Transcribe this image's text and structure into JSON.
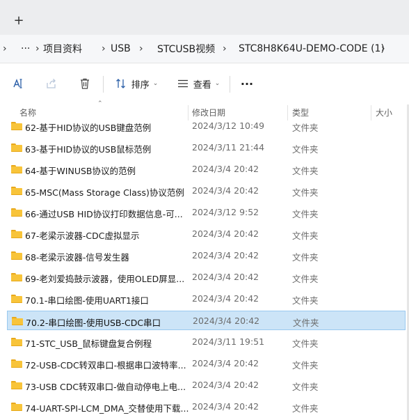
{
  "tabbar": {
    "new_tab_glyph": "+"
  },
  "breadcrumb": {
    "overflow": "···",
    "items": [
      "项目资料",
      "USB",
      "STCUSB视频",
      "STC8H8K64U-DEMO-CODE (1)"
    ]
  },
  "toolbar": {
    "sort_label": "排序",
    "view_label": "查看",
    "more_glyph": "···"
  },
  "columns": {
    "name": "名称",
    "date": "修改日期",
    "type": "类型",
    "size": "大小"
  },
  "files": [
    {
      "name": "62-基于HID协议的USB键盘范例",
      "date": "2024/3/12 10:49",
      "type": "文件夹"
    },
    {
      "name": "63-基于HID协议的USB鼠标范例",
      "date": "2024/3/11 21:44",
      "type": "文件夹"
    },
    {
      "name": "64-基于WINUSB协议的范例",
      "date": "2024/3/4 20:42",
      "type": "文件夹"
    },
    {
      "name": "65-MSC(Mass Storage Class)协议范例",
      "date": "2024/3/4 20:42",
      "type": "文件夹"
    },
    {
      "name": "66-通过USB HID协议打印数据信息-可...",
      "date": "2024/3/12 9:52",
      "type": "文件夹"
    },
    {
      "name": "67-老梁示波器-CDC虚拟显示",
      "date": "2024/3/4 20:42",
      "type": "文件夹"
    },
    {
      "name": "68-老梁示波器-信号发生器",
      "date": "2024/3/4 20:42",
      "type": "文件夹"
    },
    {
      "name": "69-老刘爱捣鼓示波器，使用OLED屏显...",
      "date": "2024/3/4 20:42",
      "type": "文件夹"
    },
    {
      "name": "70.1-串口绘图-使用UART1接口",
      "date": "2024/3/4 20:42",
      "type": "文件夹"
    },
    {
      "name": "70.2-串口绘图-使用USB-CDC串口",
      "date": "2024/3/4 20:42",
      "type": "文件夹",
      "selected": true
    },
    {
      "name": "71-STC_USB_鼠标键盘复合例程",
      "date": "2024/3/11 19:51",
      "type": "文件夹"
    },
    {
      "name": "72-USB-CDC转双串口-根据串口波特率...",
      "date": "2024/3/4 20:42",
      "type": "文件夹"
    },
    {
      "name": "73-USB CDC转双串口-做自动停电上电...",
      "date": "2024/3/4 20:42",
      "type": "文件夹"
    },
    {
      "name": "74-UART-SPI-LCM_DMA_交替使用下载...",
      "date": "2024/3/4 20:42",
      "type": "文件夹"
    }
  ],
  "colors": {
    "folder": "#f8c43a",
    "selection": "#cce4f7",
    "selection_border": "#99c9ef"
  }
}
